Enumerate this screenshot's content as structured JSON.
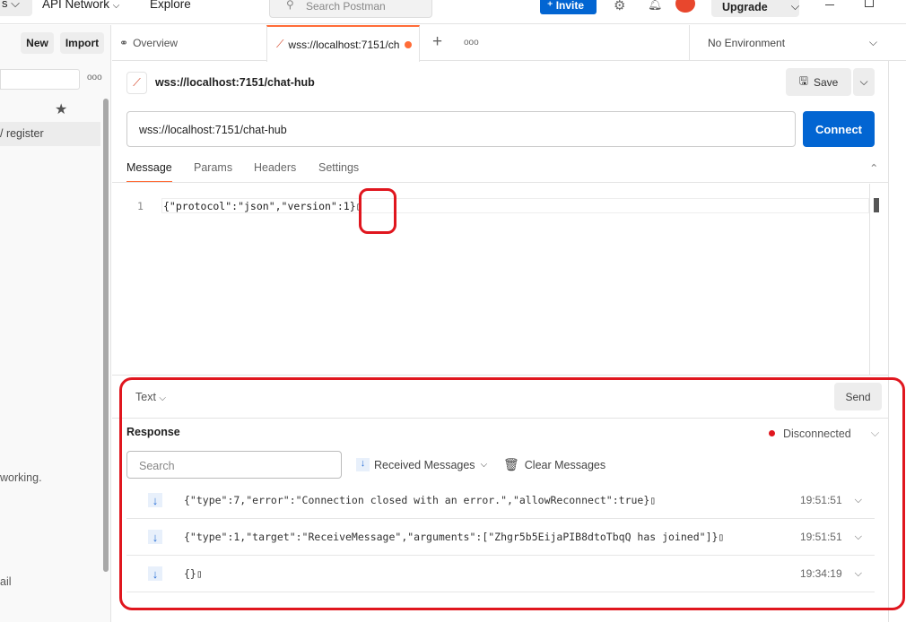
{
  "topbar": {
    "workspaces_partial": "s",
    "api_network": "API Network",
    "explore": "Explore",
    "search_placeholder": "Search Postman",
    "invite": "Invite",
    "upgrade": "Upgrade"
  },
  "sidebar": {
    "new": "New",
    "import": "Import",
    "item_partial": "/ register",
    "text_partial1": "working.",
    "text_partial2": "ail"
  },
  "tabs": {
    "overview": "Overview",
    "active": "wss://localhost:7151/ch",
    "environment": "No Environment"
  },
  "request": {
    "title": "wss://localhost:7151/chat-hub",
    "save": "Save",
    "url": "wss://localhost:7151/chat-hub",
    "connect": "Connect",
    "subtabs": [
      "Message",
      "Params",
      "Headers",
      "Settings"
    ],
    "editor": {
      "line_number": "1",
      "content": "{\"protocol\":\"json\",\"version\":1}▯"
    },
    "format": "Text",
    "send": "Send"
  },
  "response": {
    "title": "Response",
    "status": "Disconnected",
    "status_color": "#e0161e",
    "search_placeholder": "Search",
    "filter": "Received Messages",
    "clear": "Clear Messages",
    "messages": [
      {
        "text": "{\"type\":7,\"error\":\"Connection closed with an error.\",\"allowReconnect\":true}▯",
        "time": "19:51:51"
      },
      {
        "text": "{\"type\":1,\"target\":\"ReceiveMessage\",\"arguments\":[\"Zhgr5b5EijaPIB8dtoTbqQ has joined\"]}▯",
        "time": "19:51:51"
      },
      {
        "text": "{}▯",
        "time": "19:34:19"
      }
    ]
  },
  "colors": {
    "accent": "#ff6c37",
    "primary": "#0265d2",
    "annotation": "#e0161e"
  }
}
